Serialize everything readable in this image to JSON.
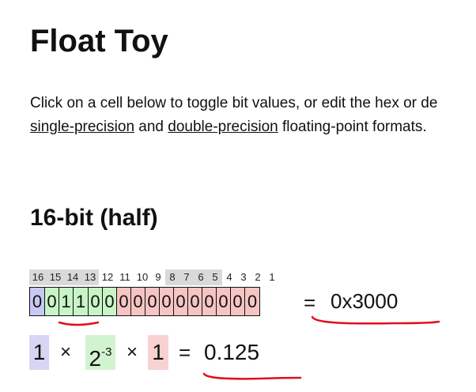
{
  "page": {
    "title": "Float Toy",
    "intro_line1": "Click on a cell below to toggle bit values, or edit the hex or de",
    "intro_line2_link1": "single-precision",
    "intro_line2_mid": " and ",
    "intro_line2_link2": "double-precision",
    "intro_line2_tail": " floating-point formats."
  },
  "half": {
    "heading": "16-bit (half)",
    "bit_labels": [
      "16",
      "15",
      "14",
      "13",
      "12",
      "11",
      "10",
      "9",
      "8",
      "7",
      "6",
      "5",
      "4",
      "3",
      "2",
      "1"
    ],
    "bits": [
      "0",
      "0",
      "1",
      "1",
      "0",
      "0",
      "0",
      "0",
      "0",
      "0",
      "0",
      "0",
      "0",
      "0",
      "0",
      "0"
    ],
    "hex_equals": "=",
    "hex_value": "0x3000",
    "formula": {
      "sign": "1",
      "times1": "×",
      "exp_base": "2",
      "exp_power": "-3",
      "times2": "×",
      "mantissa": "1",
      "equals": "=",
      "decimal_value": "0.125"
    }
  },
  "colors": {
    "sign": "#c8c8f2",
    "exponent": "#c8f5c6",
    "mantissa": "#f7c4c4",
    "annotation": "#e0101c"
  }
}
